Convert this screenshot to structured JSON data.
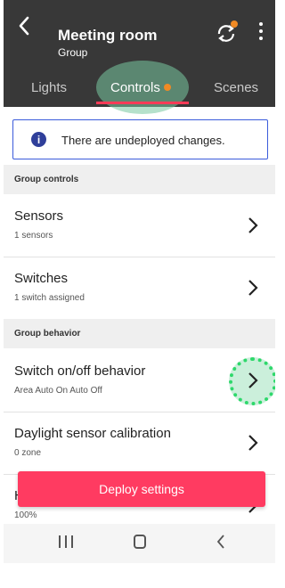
{
  "header": {
    "title": "Meeting room",
    "subtitle": "Group"
  },
  "tabs": [
    {
      "label": "Lights"
    },
    {
      "label": "Controls",
      "active": true,
      "has_notification_dot": true
    },
    {
      "label": "Scenes"
    }
  ],
  "notice": {
    "icon": "info-icon",
    "icon_glyph": "i",
    "text": "There are undeployed changes."
  },
  "sections": {
    "group_controls": "Group controls",
    "group_behavior": "Group behavior"
  },
  "items": {
    "sensors": {
      "title": "Sensors",
      "subtitle": "1 sensors"
    },
    "switches": {
      "title": "Switches",
      "subtitle": "1 switch assigned"
    },
    "onoff": {
      "title": "Switch on/off behavior",
      "subtitle": "Area Auto On Auto Off"
    },
    "daylight": {
      "title": "Daylight sensor calibration",
      "subtitle": "0 zone"
    },
    "hidden": {
      "title": "H",
      "subtitle": "100%"
    }
  },
  "deploy_button": {
    "label": "Deploy settings"
  },
  "colors": {
    "header_bg": "#383838",
    "accent": "#ff3b61",
    "notification_dot": "#f08a24",
    "notice_border": "#3b5bdb"
  }
}
